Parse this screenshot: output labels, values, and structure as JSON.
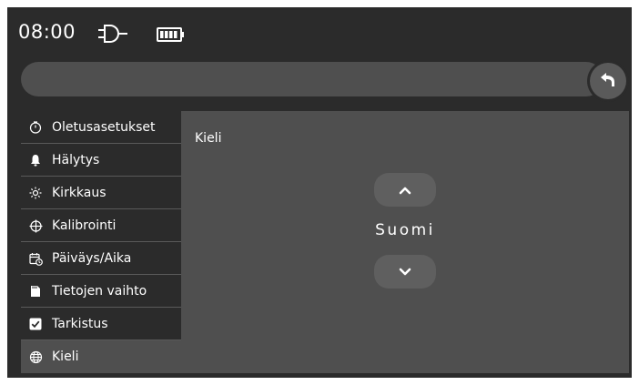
{
  "status": {
    "time": "08:00",
    "icons": [
      "power-plug-icon",
      "battery-icon"
    ]
  },
  "navbar": {
    "path": "",
    "back_icon": "back-arrow-icon"
  },
  "sidebar": {
    "items": [
      {
        "label": "Oletusasetukset",
        "icon": "timer-icon"
      },
      {
        "label": "Hälytys",
        "icon": "bell-icon"
      },
      {
        "label": "Kirkkaus",
        "icon": "sun-icon"
      },
      {
        "label": "Kalibrointi",
        "icon": "crosshair-icon"
      },
      {
        "label": "Päiväys/Aika",
        "icon": "calendar-clock-icon"
      },
      {
        "label": "Tietojen vaihto",
        "icon": "sd-card-icon"
      },
      {
        "label": "Tarkistus",
        "icon": "checkbox-icon"
      },
      {
        "label": "Kieli",
        "icon": "globe-icon",
        "active": true
      }
    ]
  },
  "content": {
    "title": "Kieli",
    "selected_value": "Suomi",
    "up_icon": "chevron-up-icon",
    "down_icon": "chevron-down-icon"
  },
  "colors": {
    "background": "#2b2b2b",
    "panel": "#4f4f4f",
    "button": "#5f5f5f",
    "text": "#ffffff"
  }
}
